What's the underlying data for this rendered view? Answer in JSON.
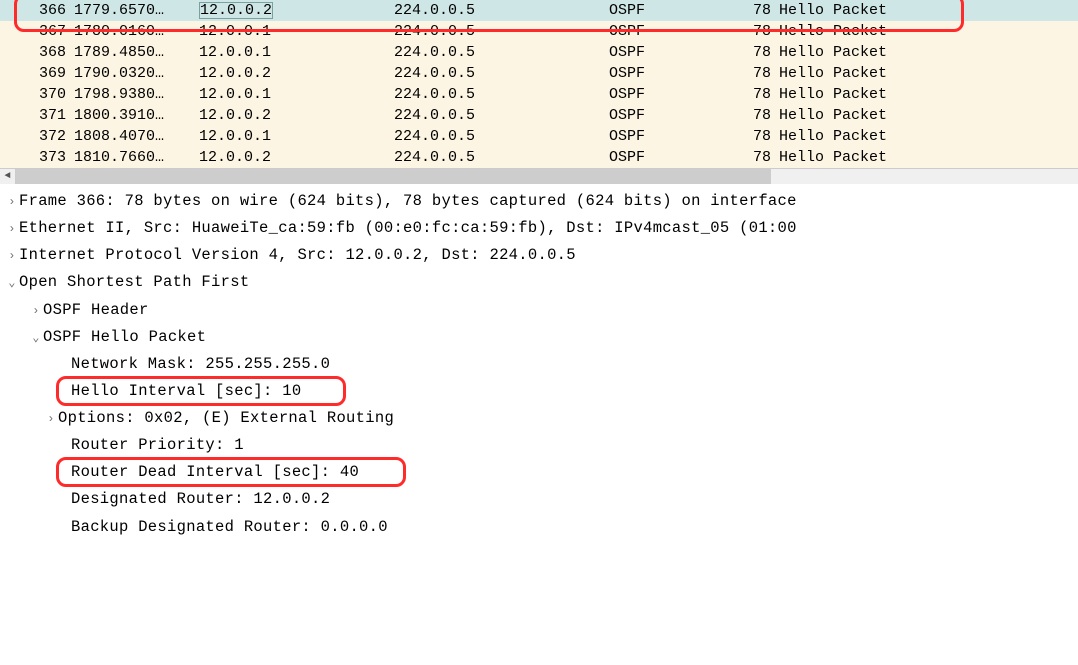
{
  "packets": [
    {
      "no": "366",
      "time": "1779.6570…",
      "src": "12.0.0.2",
      "dst": "224.0.0.5",
      "proto": "OSPF",
      "len": "78",
      "info": "Hello Packet",
      "selected": true
    },
    {
      "no": "367",
      "time": "1780.0160…",
      "src": "12.0.0.1",
      "dst": "224.0.0.5",
      "proto": "OSPF",
      "len": "78",
      "info": "Hello Packet"
    },
    {
      "no": "368",
      "time": "1789.4850…",
      "src": "12.0.0.1",
      "dst": "224.0.0.5",
      "proto": "OSPF",
      "len": "78",
      "info": "Hello Packet"
    },
    {
      "no": "369",
      "time": "1790.0320…",
      "src": "12.0.0.2",
      "dst": "224.0.0.5",
      "proto": "OSPF",
      "len": "78",
      "info": "Hello Packet"
    },
    {
      "no": "370",
      "time": "1798.9380…",
      "src": "12.0.0.1",
      "dst": "224.0.0.5",
      "proto": "OSPF",
      "len": "78",
      "info": "Hello Packet"
    },
    {
      "no": "371",
      "time": "1800.3910…",
      "src": "12.0.0.2",
      "dst": "224.0.0.5",
      "proto": "OSPF",
      "len": "78",
      "info": "Hello Packet"
    },
    {
      "no": "372",
      "time": "1808.4070…",
      "src": "12.0.0.1",
      "dst": "224.0.0.5",
      "proto": "OSPF",
      "len": "78",
      "info": "Hello Packet"
    },
    {
      "no": "373",
      "time": "1810.7660…",
      "src": "12.0.0.2",
      "dst": "224.0.0.5",
      "proto": "OSPF",
      "len": "78",
      "info": "Hello Packet"
    }
  ],
  "details": {
    "frame": "Frame 366: 78 bytes on wire (624 bits), 78 bytes captured (624 bits) on interface",
    "eth": "Ethernet II, Src: HuaweiTe_ca:59:fb (00:e0:fc:ca:59:fb), Dst: IPv4mcast_05 (01:00",
    "ip": "Internet Protocol Version 4, Src: 12.0.0.2, Dst: 224.0.0.5",
    "ospf": "Open Shortest Path First",
    "ospf_header": "OSPF Header",
    "ospf_hello": "OSPF Hello Packet",
    "netmask": "Network Mask: 255.255.255.0",
    "hello_int": "Hello Interval [sec]: 10",
    "options": "Options: 0x02, (E) External Routing",
    "priority": "Router Priority: 1",
    "dead_int": "Router Dead Interval [sec]: 40",
    "dr": "Designated Router: 12.0.0.2",
    "bdr": "Backup Designated Router: 0.0.0.0"
  }
}
